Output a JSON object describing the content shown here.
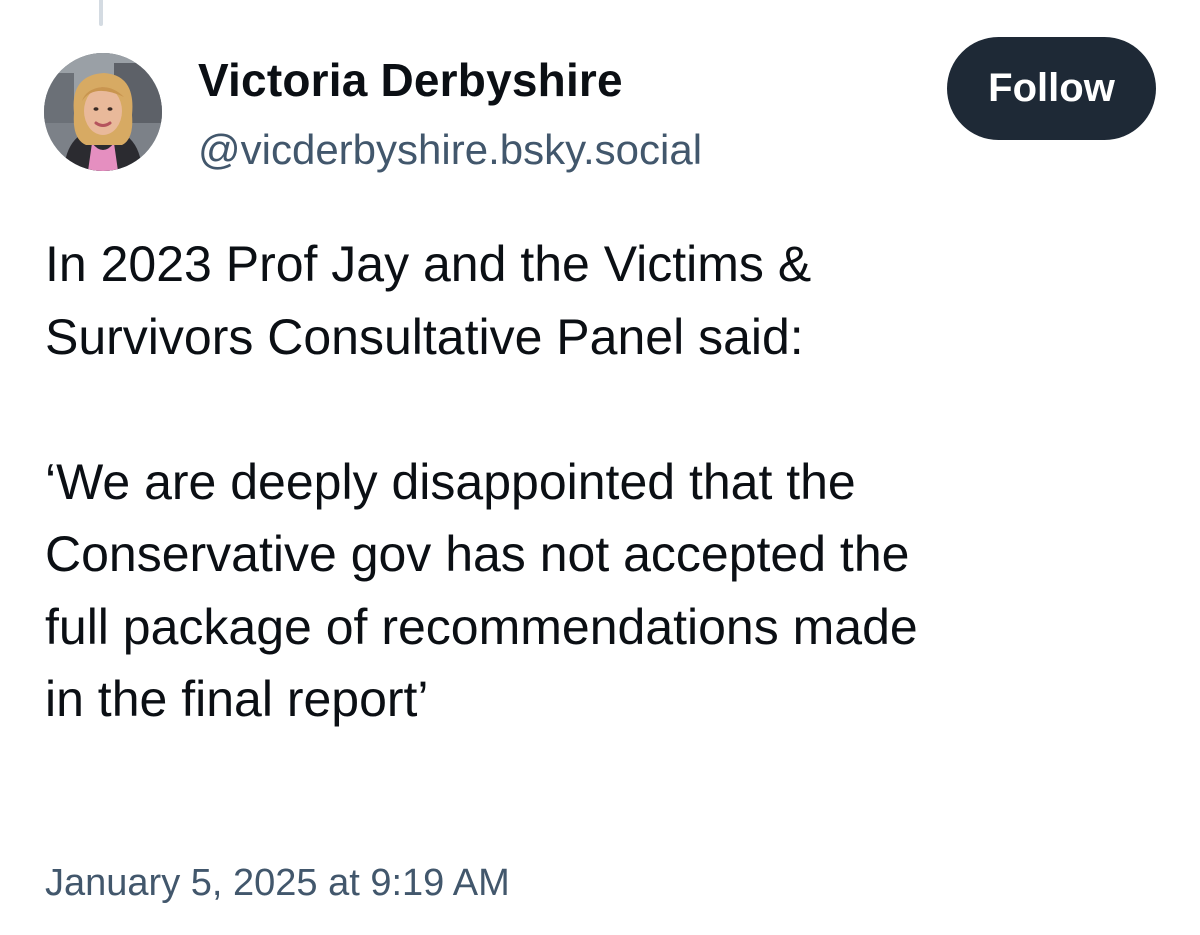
{
  "post": {
    "author": {
      "display_name": "Victoria Derbyshire",
      "handle": "@vicderbyshire.bsky.social"
    },
    "follow_label": "Follow",
    "body_lines": [
      "In 2023 Prof Jay and the Victims &",
      "Survivors Consultative Panel said:",
      "‘We are deeply disappointed that the",
      "Conservative gov has not accepted the",
      "full package of recommendations made",
      "in the final report’"
    ],
    "timestamp": "January 5, 2025 at 9:19 AM"
  },
  "colors": {
    "follow_button_bg": "#1e2936",
    "handle_text": "#42576c",
    "thread_line": "#d4dbe2"
  }
}
